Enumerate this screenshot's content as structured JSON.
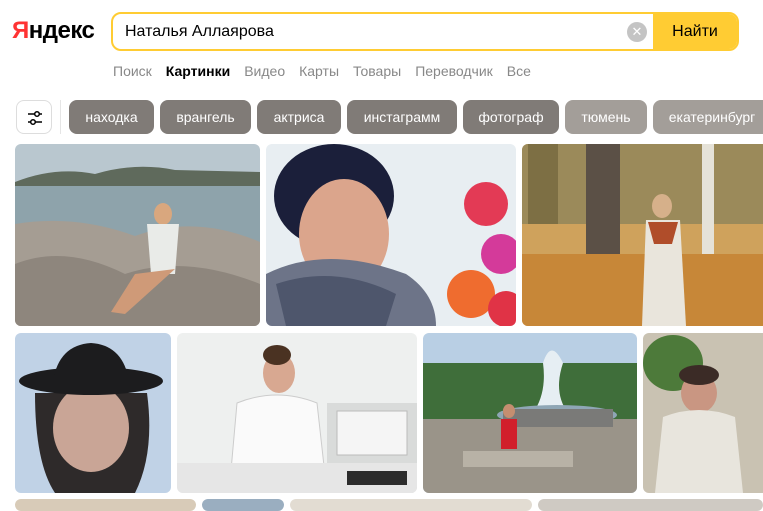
{
  "logo": {
    "first_letter": "Я",
    "rest": "ндекс"
  },
  "search": {
    "value": "Наталья Аллаярова",
    "button_label": "Найти",
    "clear_glyph": "✕"
  },
  "nav": {
    "items": [
      "Поиск",
      "Картинки",
      "Видео",
      "Карты",
      "Товары",
      "Переводчик",
      "Все"
    ],
    "active_index": 1
  },
  "chips": [
    "находка",
    "врангель",
    "актриса",
    "инстаграмм",
    "фотограф",
    "тюмень",
    "екатеринбург"
  ],
  "icons": {
    "filter": "sliders-icon",
    "clear": "close-icon"
  },
  "colors": {
    "accent": "#ffcc33",
    "logo_red": "#ff3333",
    "chip_bg": "#807b77"
  },
  "images": [
    {
      "name": "woman-on-rocks-sea"
    },
    {
      "name": "woman-fur-collar-flowers"
    },
    {
      "name": "woman-autumn-tree"
    },
    {
      "name": "woman-black-hat"
    },
    {
      "name": "doctor-at-desk"
    },
    {
      "name": "girl-by-fountain"
    },
    {
      "name": "woman-near-plant"
    }
  ]
}
